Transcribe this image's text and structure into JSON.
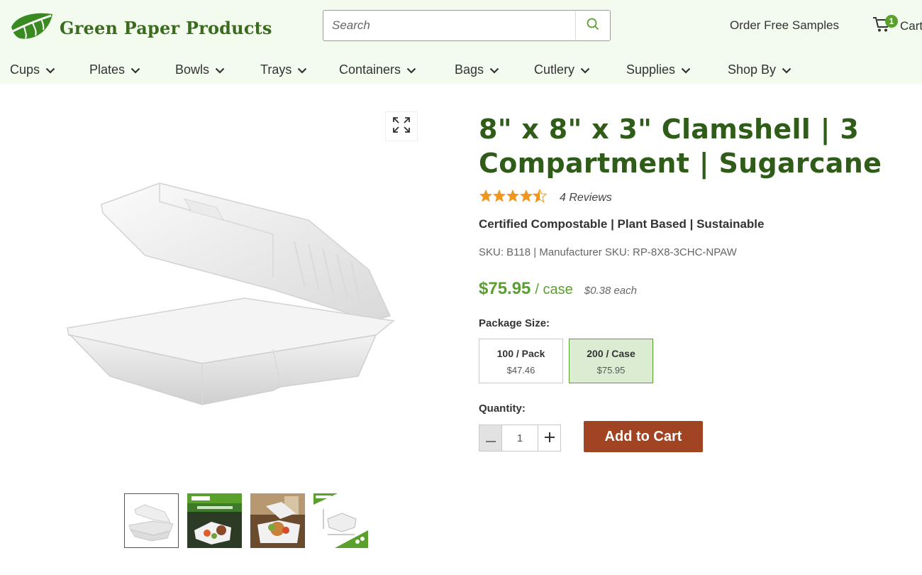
{
  "header": {
    "logo_text": "Green Paper Products",
    "search_placeholder": "Search",
    "samples_link": "Order Free Samples",
    "cart_label": "Cart",
    "cart_count": "1"
  },
  "nav": {
    "items": [
      {
        "label": "Cups"
      },
      {
        "label": "Plates"
      },
      {
        "label": "Bowls"
      },
      {
        "label": "Trays"
      },
      {
        "label": "Containers"
      },
      {
        "label": "Bags"
      },
      {
        "label": "Cutlery"
      },
      {
        "label": "Supplies"
      },
      {
        "label": "Shop By"
      }
    ]
  },
  "product": {
    "title": "8\" x 8\" x 3\" Clamshell | 3 Compartment | Sugarcane",
    "rating": 4.5,
    "reviews_text": "4 Reviews",
    "tagline": "Certified Compostable | Plant Based | Sustainable",
    "sku_line": "SKU: B118  |  Manufacturer SKU: RP-8X8-3CHC-NPAW",
    "price": "$75.95",
    "price_unit": "/ case",
    "price_each": "$0.38 each",
    "package_label": "Package Size:",
    "options": [
      {
        "name": "100 / Pack",
        "price": "$47.46",
        "selected": false
      },
      {
        "name": "200 / Case",
        "price": "$75.95",
        "selected": true
      }
    ],
    "quantity_label": "Quantity:",
    "quantity_value": "1",
    "add_to_cart_label": "Add to Cart"
  },
  "gallery": {
    "thumbnails": [
      {
        "name": "clamshell-thumb",
        "active": true
      },
      {
        "name": "responsible-box-thumb",
        "active": false
      },
      {
        "name": "food-photo-thumb",
        "active": false
      },
      {
        "name": "dimensions-thumb",
        "active": false
      }
    ]
  },
  "colors": {
    "header_bg": "#f3fbef",
    "brand_green": "#3a6b1e",
    "title_green": "#2f5c18",
    "price_green": "#5aa02c",
    "star_orange": "#f0961e",
    "add_to_cart_bg": "#a04424",
    "selected_option_bg": "#dbecd2"
  },
  "icons": {
    "logo": "leaf-icon",
    "search": "search-icon",
    "cart": "cart-icon",
    "nav_chevron": "chevron-down-icon",
    "zoom": "expand-icon",
    "rating": "star-icon"
  }
}
